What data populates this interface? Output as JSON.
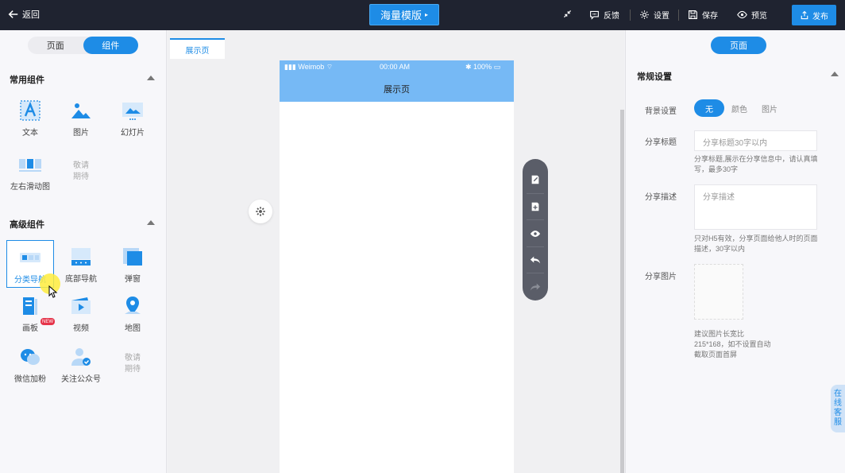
{
  "topbar": {
    "back_label": "返回",
    "template_label": "海量模版",
    "actions": {
      "feedback": "反馈",
      "settings": "设置",
      "save": "保存",
      "preview": "预览"
    },
    "publish_label": "发布"
  },
  "left_panel": {
    "tabs": [
      "页面",
      "组件"
    ],
    "active_tab": "组件",
    "common_group": {
      "title": "常用组件",
      "items": [
        "文本",
        "图片",
        "幻灯片",
        "左右滑动图",
        "敬请期待"
      ]
    },
    "advanced_group": {
      "title": "高级组件",
      "items": [
        "分类导航",
        "底部导航",
        "弹窗",
        "画板",
        "视频",
        "地图",
        "微信加粉",
        "关注公众号",
        "敬请期待"
      ],
      "new_badge": "NEW"
    }
  },
  "canvas": {
    "page_tab": "展示页",
    "phone": {
      "carrier": "Weimob",
      "time": "00:00 AM",
      "battery": "100%",
      "title": "展示页"
    }
  },
  "right_panel": {
    "pill": "页面",
    "section_title": "常规设置",
    "background": {
      "label": "背景设置",
      "options": [
        "无",
        "颜色",
        "图片"
      ],
      "selected": "无"
    },
    "share_title": {
      "label": "分享标题",
      "placeholder": "分享标题30字以内",
      "help": "分享标题,展示在分享信息中，请认真填写，最多30字"
    },
    "share_desc": {
      "label": "分享描述",
      "placeholder": "分享描述",
      "help": "只对H5有效，分享页面给他人时的页面描述，30字以内"
    },
    "share_image": {
      "label": "分享图片",
      "help_line1": "建议图片长宽比",
      "help_line2": "215*168，如不设置自动",
      "help_line3": "截取页面首屏"
    }
  },
  "online_service": "在线客服",
  "colors": {
    "topbar_bg": "#1f2330",
    "accent": "#1e8ce6",
    "phone_header": "#76b9f5"
  }
}
